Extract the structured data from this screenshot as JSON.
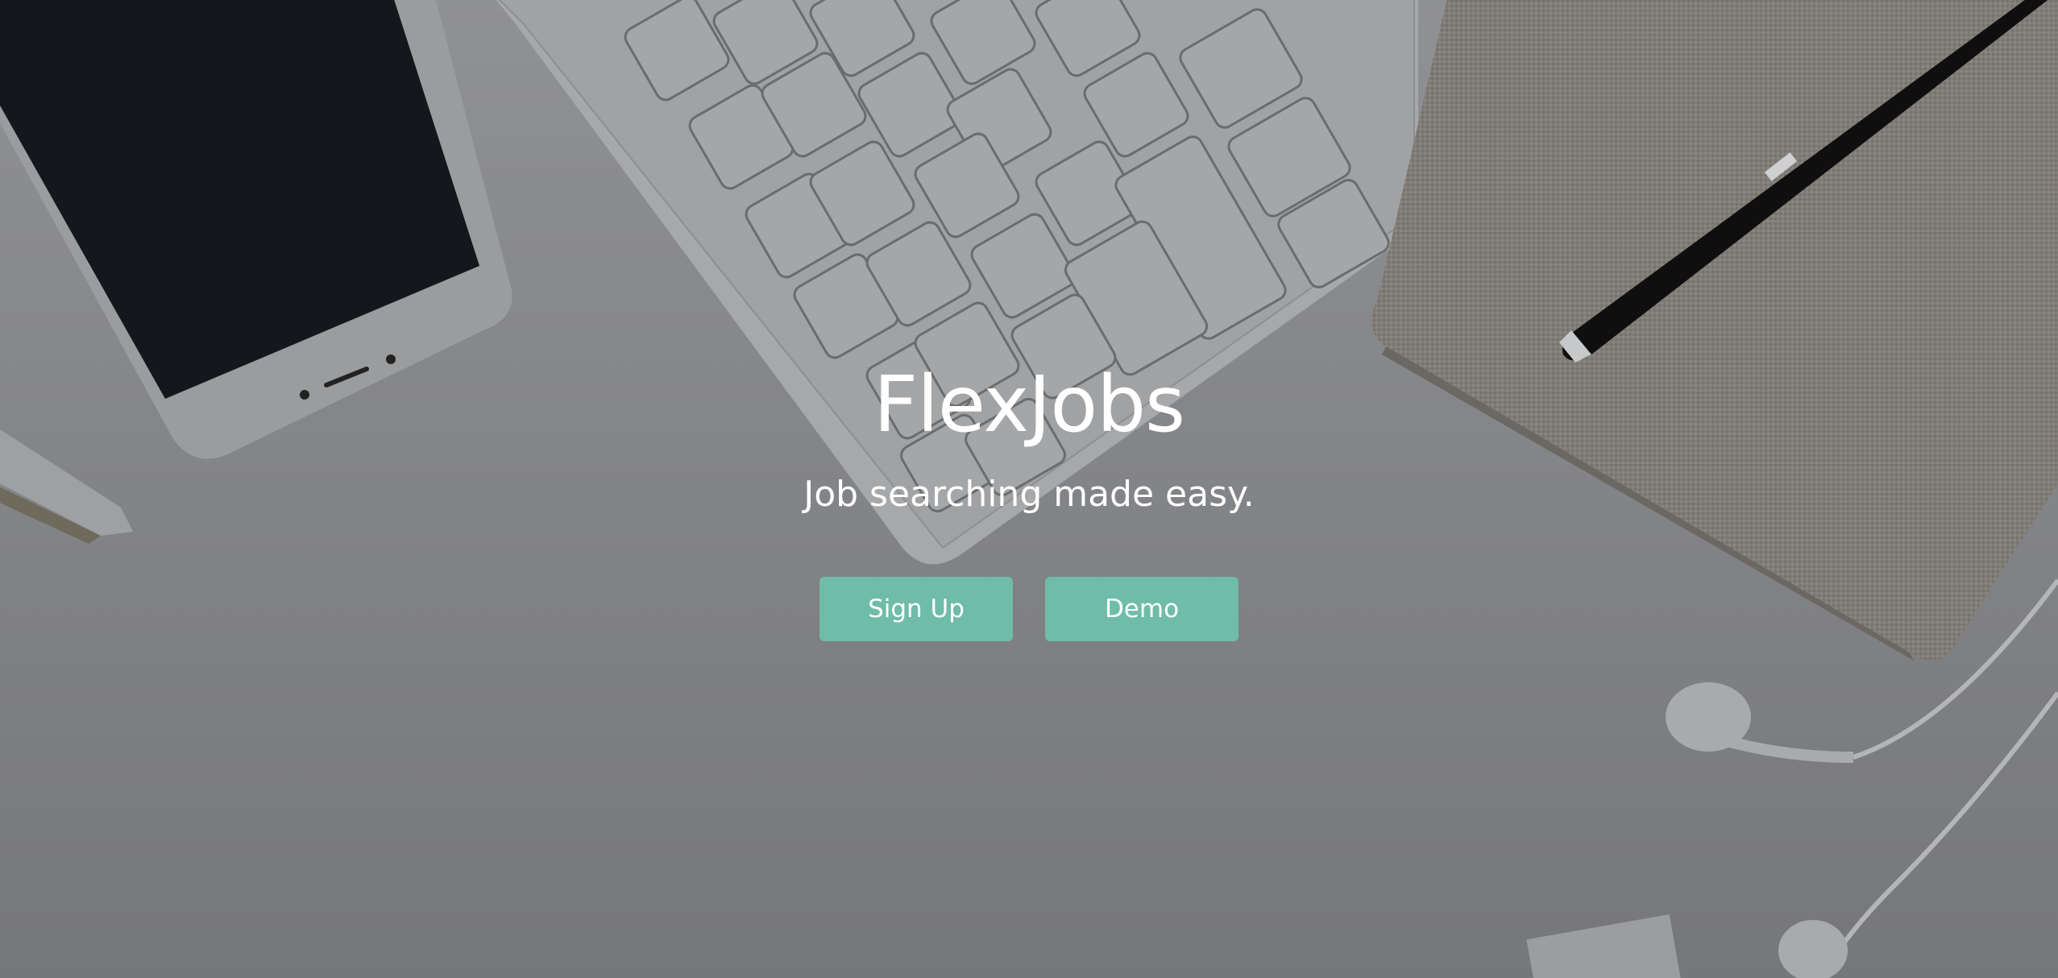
{
  "hero": {
    "title": "FlexJobs",
    "subtitle": "Job searching made easy.",
    "buttons": {
      "signup_label": "Sign Up",
      "demo_label": "Demo"
    },
    "colors": {
      "button": "#6fbca8",
      "text": "#ffffff",
      "background": "#8b8c8f"
    },
    "background_image": "desk-flatlay-photo"
  }
}
